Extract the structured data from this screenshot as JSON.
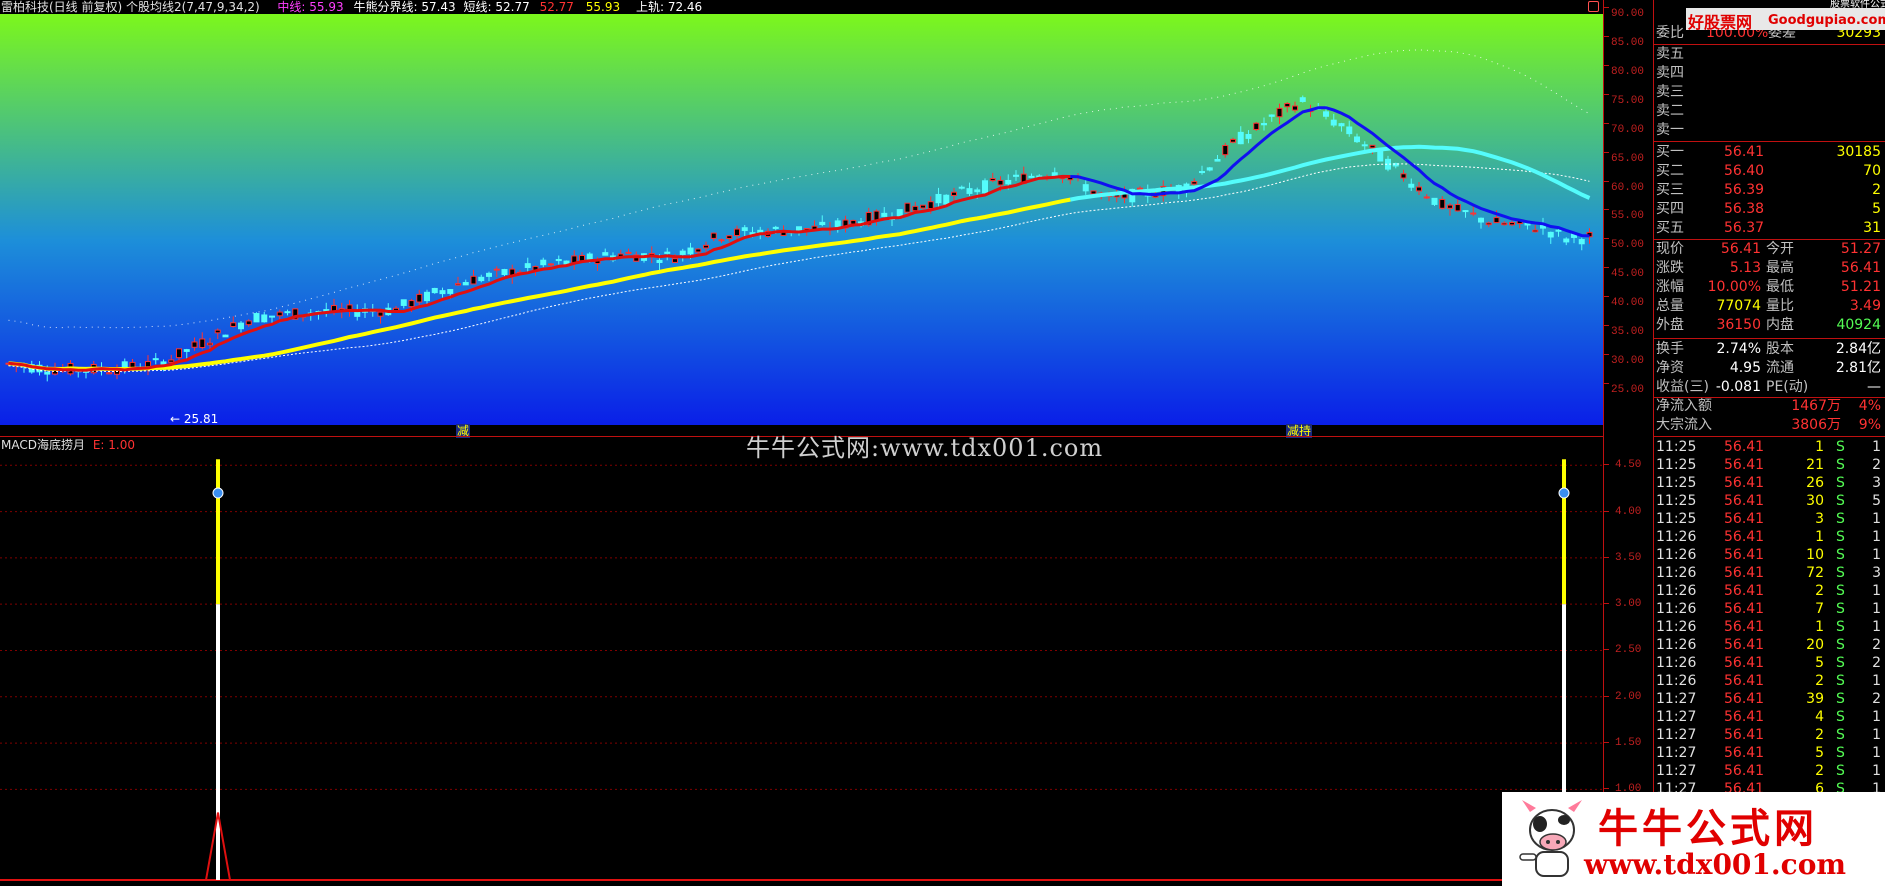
{
  "header": {
    "stock_title": "雷柏科技(日线 前复权)",
    "indicator_name": "个股均线2(7,47,9,34,2)",
    "mid_label": "中线:",
    "mid_value": "55.93",
    "bull_bear_label": "牛熊分界线:",
    "bull_bear_value": "57.43",
    "short_label": "短线:",
    "short_value": "52.77",
    "v4": "52.77",
    "v5": "55.93",
    "upper_label": "上轨:",
    "upper_value": "72.46"
  },
  "price_axis": [
    "90.00",
    "85.00",
    "80.00",
    "75.00",
    "70.00",
    "65.00",
    "60.00",
    "55.00",
    "50.00",
    "45.00",
    "40.00",
    "35.00",
    "30.00",
    "25.00"
  ],
  "chart_marks": {
    "low_label": "25.81",
    "signal_1": "减",
    "signal_2": "减持"
  },
  "sub_chart": {
    "title": "MACD海底捞月",
    "e_label": "E: 1.00",
    "axis": [
      "4.50",
      "4.00",
      "3.50",
      "3.00",
      "2.50",
      "2.00",
      "1.50",
      "1.00"
    ]
  },
  "order_book": {
    "wei_bi": "委比",
    "wei_cha": "委差",
    "wei_bi_val": "100.00%",
    "wei_cha_val": "30293",
    "asks": [
      "卖五",
      "卖四",
      "卖三",
      "卖二",
      "卖一"
    ],
    "bids": [
      {
        "label": "买一",
        "price": "56.41",
        "vol": "30185"
      },
      {
        "label": "买二",
        "price": "56.40",
        "vol": "70"
      },
      {
        "label": "买三",
        "price": "56.39",
        "vol": "2"
      },
      {
        "label": "买四",
        "price": "56.38",
        "vol": "5"
      },
      {
        "label": "买五",
        "price": "56.37",
        "vol": "31"
      }
    ]
  },
  "quote_stats": [
    {
      "l": "现价",
      "v": "56.41",
      "l2": "今开",
      "v2": "51.27"
    },
    {
      "l": "涨跌",
      "v": "5.13",
      "l2": "最高",
      "v2": "56.41"
    },
    {
      "l": "涨幅",
      "v": "10.00%",
      "l2": "最低",
      "v2": "51.21"
    },
    {
      "l": "总量",
      "v": "77074",
      "l2": "量比",
      "v2": "3.49"
    },
    {
      "l": "外盘",
      "v": "36150",
      "l2": "内盘",
      "v2": "40924"
    },
    {
      "l": "换手",
      "v": "2.74%",
      "l2": "股本",
      "v2": "2.84亿"
    },
    {
      "l": "净资",
      "v": "4.95",
      "l2": "流通",
      "v2": "2.81亿"
    },
    {
      "l": "收益(三)",
      "v": "-0.081",
      "l2": "PE(动)",
      "v2": "—"
    }
  ],
  "flows": [
    {
      "l": "净流入额",
      "v": "1467万",
      "p": "4%"
    },
    {
      "l": "大宗流入",
      "v": "3806万",
      "p": "9%"
    }
  ],
  "ticks": [
    {
      "t": "11:25",
      "p": "56.41",
      "v": "1",
      "s": "S",
      "n": "1"
    },
    {
      "t": "11:25",
      "p": "56.41",
      "v": "21",
      "s": "S",
      "n": "2"
    },
    {
      "t": "11:25",
      "p": "56.41",
      "v": "26",
      "s": "S",
      "n": "3"
    },
    {
      "t": "11:25",
      "p": "56.41",
      "v": "30",
      "s": "S",
      "n": "5"
    },
    {
      "t": "11:25",
      "p": "56.41",
      "v": "3",
      "s": "S",
      "n": "1"
    },
    {
      "t": "11:26",
      "p": "56.41",
      "v": "1",
      "s": "S",
      "n": "1"
    },
    {
      "t": "11:26",
      "p": "56.41",
      "v": "10",
      "s": "S",
      "n": "1"
    },
    {
      "t": "11:26",
      "p": "56.41",
      "v": "72",
      "s": "S",
      "n": "3"
    },
    {
      "t": "11:26",
      "p": "56.41",
      "v": "2",
      "s": "S",
      "n": "1"
    },
    {
      "t": "11:26",
      "p": "56.41",
      "v": "7",
      "s": "S",
      "n": "1"
    },
    {
      "t": "11:26",
      "p": "56.41",
      "v": "1",
      "s": "S",
      "n": "1"
    },
    {
      "t": "11:26",
      "p": "56.41",
      "v": "20",
      "s": "S",
      "n": "2"
    },
    {
      "t": "11:26",
      "p": "56.41",
      "v": "5",
      "s": "S",
      "n": "2"
    },
    {
      "t": "11:26",
      "p": "56.41",
      "v": "2",
      "s": "S",
      "n": "1"
    },
    {
      "t": "11:27",
      "p": "56.41",
      "v": "39",
      "s": "S",
      "n": "2"
    },
    {
      "t": "11:27",
      "p": "56.41",
      "v": "4",
      "s": "S",
      "n": "1"
    },
    {
      "t": "11:27",
      "p": "56.41",
      "v": "2",
      "s": "S",
      "n": "1"
    },
    {
      "t": "11:27",
      "p": "56.41",
      "v": "5",
      "s": "S",
      "n": "1"
    },
    {
      "t": "11:27",
      "p": "56.41",
      "v": "2",
      "s": "S",
      "n": "1"
    },
    {
      "t": "11:27",
      "p": "56.41",
      "v": "6",
      "s": "S",
      "n": "1"
    }
  ],
  "watermarks": {
    "top_logo": "好股票网",
    "top_logo_url": "Goodgupiao.com",
    "top_logo_sub": "股票软件公式",
    "center": "牛牛公式网:www.tdx001.com",
    "corner_title": "牛牛公式网",
    "corner_url": "www.tdx001.com"
  },
  "colors": {
    "up": "#ff3232",
    "down": "#54fcfc",
    "yellow": "#ffff00",
    "grid": "#800000",
    "border": "#c01010"
  }
}
